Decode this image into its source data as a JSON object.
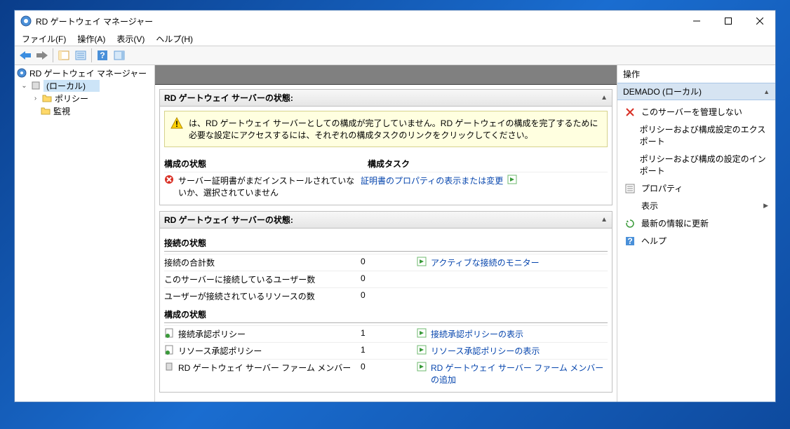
{
  "window": {
    "title": "RD ゲートウェイ マネージャー"
  },
  "menu": {
    "file": "ファイル(F)",
    "action": "操作(A)",
    "view": "表示(V)",
    "help": "ヘルプ(H)"
  },
  "tree": {
    "root": "RD ゲートウェイ マネージャー",
    "local": "(ローカル)",
    "policy": "ポリシー",
    "monitor": "監視"
  },
  "panel1": {
    "title": "RD ゲートウェイ サーバーの状態:",
    "warning": "は、RD ゲートウェイ サーバーとしての構成が完了していません。RD ゲートウェイの構成を完了するために必要な設定にアクセスするには、それぞれの構成タスクのリンクをクリックしてください。",
    "col_status": "構成の状態",
    "col_task": "構成タスク",
    "cert_status": "サーバー証明書がまだインストールされていないか、選択されていません",
    "cert_task": "証明書のプロパティの表示または変更"
  },
  "panel2": {
    "title": "RD ゲートウェイ サーバーの状態:",
    "conn_head": "接続の状態",
    "total_conn": "接続の合計数",
    "total_conn_v": "0",
    "users_conn": "このサーバーに接続しているユーザー数",
    "users_conn_v": "0",
    "res_conn": "ユーザーが接続されているリソースの数",
    "res_conn_v": "0",
    "monitor_link": "アクティブな接続のモニター",
    "config_head": "構成の状態",
    "cap": "接続承認ポリシー",
    "cap_v": "1",
    "cap_link": "接続承認ポリシーの表示",
    "rap": "リソース承認ポリシー",
    "rap_v": "1",
    "rap_link": "リソース承認ポリシーの表示",
    "farm": "RD ゲートウェイ サーバー ファーム メンバー",
    "farm_v": "0",
    "farm_link": "RD ゲートウェイ サーバー ファーム メンバーの追加"
  },
  "actions": {
    "title": "操作",
    "header": "DEMADO (ローカル)",
    "no_manage": "このサーバーを管理しない",
    "export": "ポリシーおよび構成設定のエクスポート",
    "import": "ポリシーおよび構成の設定のインポート",
    "properties": "プロパティ",
    "view": "表示",
    "refresh": "最新の情報に更新",
    "help": "ヘルプ"
  }
}
